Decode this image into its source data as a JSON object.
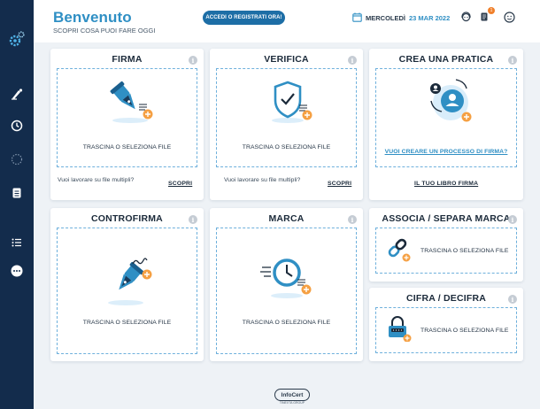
{
  "header": {
    "title": "Benvenuto",
    "subtitle": "SCOPRI COSA PUOI FARE OGGI",
    "login_button": "ACCEDI O REGISTRATI ORA!",
    "date_day": "MERCOLEDÌ",
    "date_value": "23 MAR 2022",
    "notification_count": "1"
  },
  "sidebar": {
    "items": [
      "logo",
      "sign",
      "history",
      "progress",
      "archive",
      "list",
      "more"
    ]
  },
  "cards": {
    "firma": {
      "title": "FIRMA",
      "drop": "TRASCINA O SELEZIONA FILE",
      "foot_text": "Vuoi lavorare su file multipli?",
      "foot_link": "SCOPRI"
    },
    "verifica": {
      "title": "VERIFICA",
      "drop": "TRASCINA O SELEZIONA FILE",
      "foot_text": "Vuoi lavorare su file multipli?",
      "foot_link": "SCOPRI"
    },
    "crea": {
      "title": "CREA UNA PRATICA",
      "link": "VUOI CREARE UN PROCESSO DI FIRMA?",
      "foot_link": "IL TUO LIBRO FIRMA"
    },
    "controfirma": {
      "title": "CONTROFIRMA",
      "drop": "TRASCINA O SELEZIONA FILE"
    },
    "marca": {
      "title": "MARCA",
      "drop": "TRASCINA O SELEZIONA FILE"
    },
    "associa": {
      "title": "ASSOCIA / SEPARA MARCA",
      "drop": "TRASCINA O SELEZIONA FILE"
    },
    "cifra": {
      "title": "CIFRA / DECIFRA",
      "drop": "TRASCINA O SELEZIONA FILE"
    }
  },
  "footer": {
    "logo": "InfoCert",
    "sub": "TINEXTA GROUP"
  },
  "colors": {
    "sidebar": "#132c4c",
    "accent": "#2f8fc4",
    "orange": "#f07f2a",
    "button": "#1d6ea6"
  },
  "icons": {
    "info": "i"
  }
}
